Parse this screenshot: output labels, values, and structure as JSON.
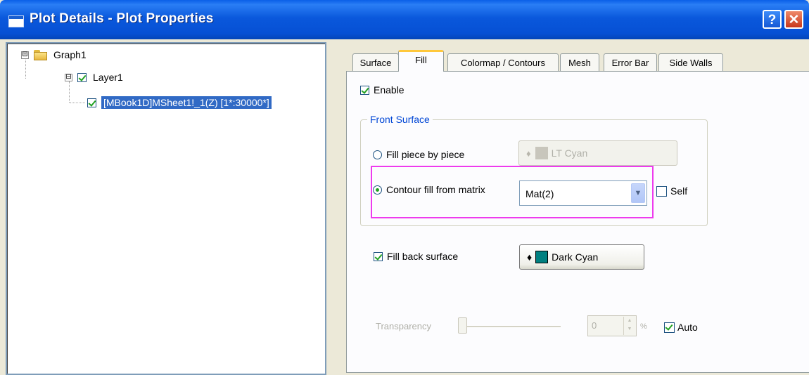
{
  "window": {
    "title": "Plot Details - Plot Properties",
    "help_label": "?",
    "close_label": "✕"
  },
  "tree": {
    "root": {
      "label": "Graph1",
      "expander": "⊟"
    },
    "layer": {
      "label": "Layer1",
      "expander": "⊟",
      "checked": true
    },
    "dataset": {
      "label": "[MBook1D]MSheet1!_1(Z) [1*:30000*]",
      "checked": true,
      "selected": true
    }
  },
  "tabs": [
    {
      "label": "Surface"
    },
    {
      "label": "Fill",
      "active": true
    },
    {
      "label": "Colormap / Contours"
    },
    {
      "label": "Mesh"
    },
    {
      "label": "Error Bar"
    },
    {
      "label": "Side Walls"
    }
  ],
  "fill_page": {
    "enable_label": "Enable",
    "enable_checked": true,
    "front_surface": {
      "group_title": "Front Surface",
      "fill_piece_label": "Fill piece by piece",
      "fill_piece_selected": false,
      "piece_color_label": "LT Cyan",
      "piece_color_hex": "#c8c6bc",
      "contour_fill_label": "Contour fill from matrix",
      "contour_fill_selected": true,
      "matrix_value": "Mat(2)",
      "self_label": "Self",
      "self_checked": false
    },
    "fill_back_label": "Fill back surface",
    "fill_back_checked": true,
    "back_color_label": "Dark Cyan",
    "back_color_hex": "#008080",
    "transparency_label": "Transparency",
    "transparency_value": "0",
    "transparency_unit": "%",
    "auto_label": "Auto",
    "auto_checked": true
  },
  "colors": {
    "highlight": "#ee3bee",
    "selection": "#316ac5",
    "group_title": "#0046d5"
  }
}
